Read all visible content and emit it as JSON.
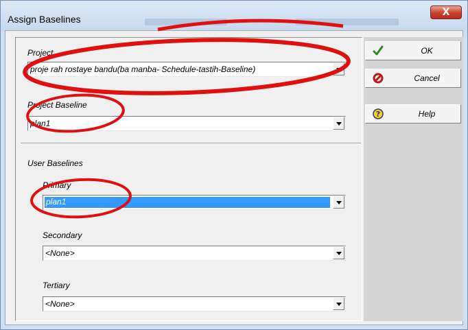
{
  "window": {
    "title": "Assign Baselines",
    "close_glyph": "X"
  },
  "project": {
    "label": "Project",
    "value": "proje rah rostaye bandu(ba manba- Schedule-tastih-Baseline)"
  },
  "project_baseline": {
    "label": "Project Baseline",
    "value": "plan1"
  },
  "user_baselines": {
    "heading": "User Baselines",
    "primary": {
      "label": "Primary",
      "value": "plan1"
    },
    "secondary": {
      "label": "Secondary",
      "value": "<None>"
    },
    "tertiary": {
      "label": "Tertiary",
      "value": "<None>"
    }
  },
  "buttons": {
    "ok": "OK",
    "cancel": "Cancel",
    "help": "Help"
  },
  "colors": {
    "annotation": "#e01010",
    "selection": "#3399ff",
    "ok_check": "#2e8b1e",
    "cancel_icon": "#c0141c",
    "help_icon": "#f0d020"
  }
}
